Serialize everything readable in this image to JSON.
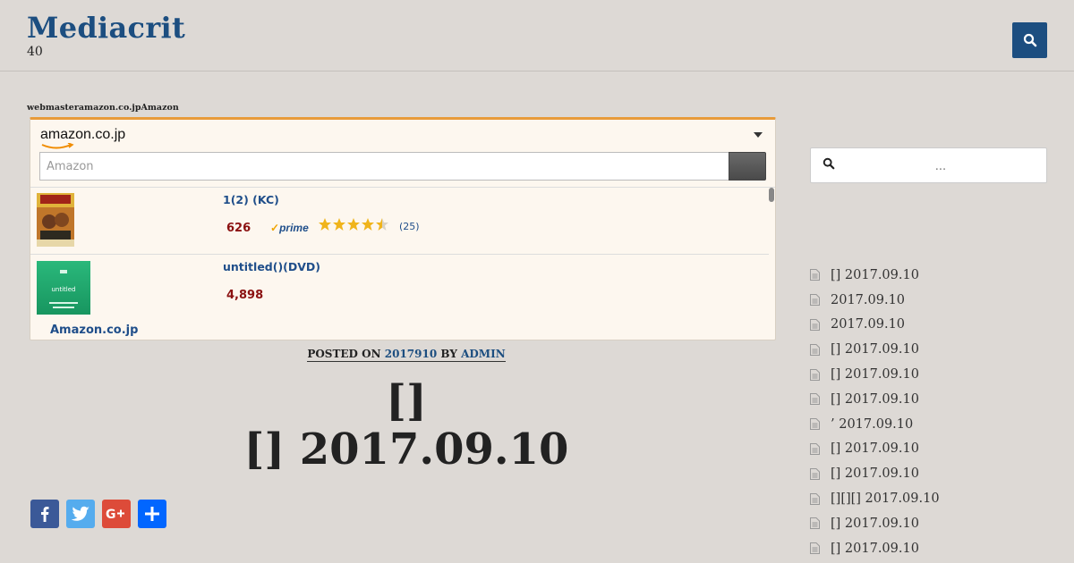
{
  "header": {
    "site_title": "Mediacrit",
    "site_description": "40"
  },
  "main": {
    "disclaimer": "webmasteramazon.co.jpAmazon",
    "amazon_widget": {
      "logo_text": "amazon.co.jp",
      "search_placeholder": "Amazon",
      "items": [
        {
          "title": "1(2) (KC)",
          "price": "626",
          "prime_label": "prime",
          "rating": 4.5,
          "reviews": "(25)"
        },
        {
          "title": "untitled()(DVD)",
          "price": "4,898",
          "thumb_label": "untitled"
        }
      ],
      "footer_link": "Amazon.co.jp"
    },
    "post_meta": {
      "posted_on": "POSTED ON",
      "date": "2017910",
      "by": "BY",
      "author": "ADMIN"
    },
    "entry_title_line1": "[]",
    "entry_title_line2": "[] 2017.09.10",
    "share": {
      "facebook": "Facebook",
      "twitter": "Twitter",
      "google_plus": "Google+",
      "share": "Share"
    }
  },
  "sidebar": {
    "search_title": "",
    "search_placeholder": "...",
    "recent_title": "",
    "recent_posts": [
      "[] 2017.09.10",
      " 2017.09.10",
      " 2017.09.10",
      "[] 2017.09.10",
      "[] 2017.09.10",
      "[] 2017.09.10",
      "’ 2017.09.10",
      "[] 2017.09.10",
      "[] 2017.09.10",
      "[][][] 2017.09.10",
      "[] 2017.09.10",
      "[] 2017.09.10"
    ]
  },
  "colors": {
    "brand_blue": "#1c4e80",
    "page_background": "#ddd9d5",
    "amazon_orange": "#e89b3a",
    "price_red": "#8b1111",
    "facebook": "#3b5998",
    "twitter": "#55acee",
    "google_plus": "#dd4b39",
    "share": "#0166ff"
  }
}
